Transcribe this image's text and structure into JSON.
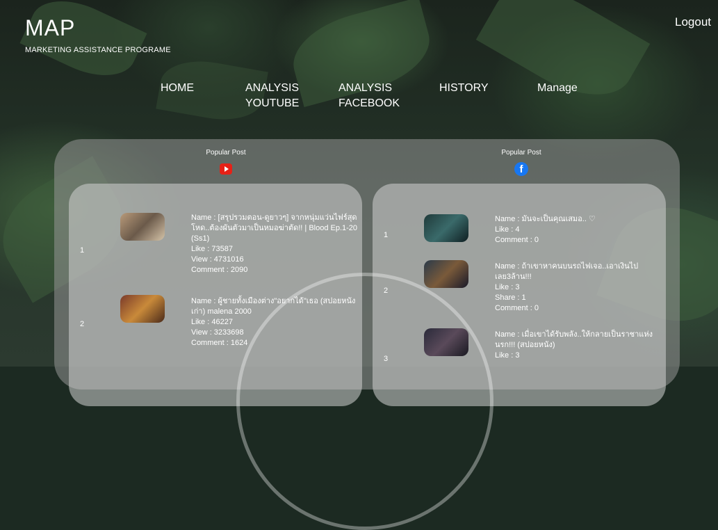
{
  "brand": {
    "title": "MAP",
    "subtitle": "MARKETING ASSISTANCE PROGRAME"
  },
  "header": {
    "logout_label": "Logout"
  },
  "nav": [
    {
      "label": "HOME"
    },
    {
      "label": "ANALYSIS\nYOUTUBE"
    },
    {
      "label": "ANALYSIS\nFACEBOOK"
    },
    {
      "label": "HISTORY"
    },
    {
      "label": "Manage"
    }
  ],
  "youtube": {
    "heading": "Popular Post",
    "icon": "youtube-icon",
    "accent": "#e62117",
    "posts": [
      {
        "rank": "1",
        "name": "Name : [สรุปรวมตอน-ดูยาวๆ] จากหนุ่มแว่นไฟร์สุดโหด..ต้องผันตัวมาเป็นหมอฆ่าตัด!! | Blood Ep.1-20 (Ss1)",
        "like": "Like : 73587",
        "view": "View : 4731016",
        "comment": "Comment : 2090"
      },
      {
        "rank": "2",
        "name": "Name : ผู้ชายทั้งเมืองต่าง\"อยากได้\"เธอ (สปอยหนังเก่า) malena 2000",
        "like": "Like : 46227",
        "view": "View : 3233698",
        "comment": "Comment : 1624"
      }
    ]
  },
  "facebook": {
    "heading": "Popular Post",
    "icon": "facebook-icon",
    "accent": "#1877f2",
    "posts": [
      {
        "rank": "1",
        "name": "Name : มันจะเป็นคุณเสมอ.. ♡",
        "like": "Like : 4",
        "comment": "Comment : 0"
      },
      {
        "rank": "2",
        "name": "Name : ถ้าเขาหาคนบนรถไฟเจอ..เอาเงินไปเลย3ล้าน!!!",
        "like": "Like : 3",
        "share": "Share : 1",
        "comment": "Comment : 0"
      },
      {
        "rank": "3",
        "name": "Name : เมื่อเขาได้รับพลัง..ให้กลายเป็นราชาแห่งนรก!!! (สปอยหนัง)",
        "like": "Like : 3"
      }
    ]
  }
}
